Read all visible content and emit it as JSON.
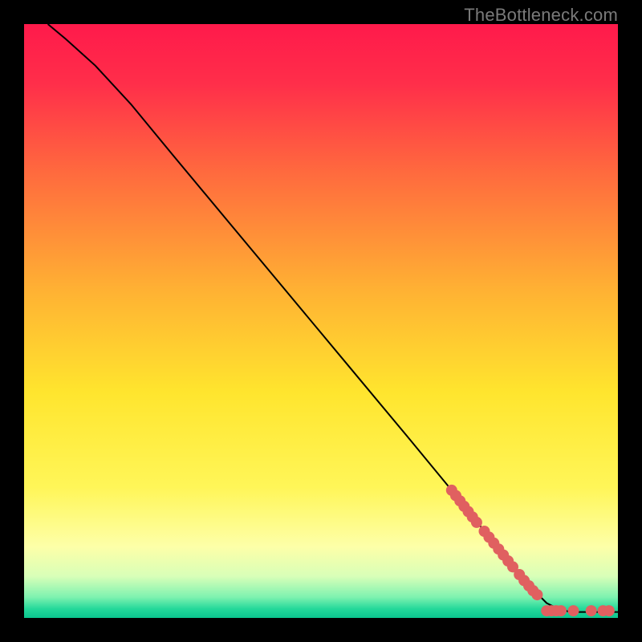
{
  "watermark": "TheBottleneck.com",
  "chart_data": {
    "type": "line",
    "title": "",
    "xlabel": "",
    "ylabel": "",
    "xlim": [
      0,
      100
    ],
    "ylim": [
      0,
      100
    ],
    "gradient_stops": [
      {
        "offset": 0.0,
        "color": "#ff1a4b"
      },
      {
        "offset": 0.1,
        "color": "#ff2e4a"
      },
      {
        "offset": 0.25,
        "color": "#ff6a3e"
      },
      {
        "offset": 0.45,
        "color": "#ffb233"
      },
      {
        "offset": 0.62,
        "color": "#ffe52e"
      },
      {
        "offset": 0.78,
        "color": "#fff658"
      },
      {
        "offset": 0.88,
        "color": "#fdffa8"
      },
      {
        "offset": 0.93,
        "color": "#d8ffb8"
      },
      {
        "offset": 0.965,
        "color": "#7ef2b0"
      },
      {
        "offset": 0.985,
        "color": "#23d89a"
      },
      {
        "offset": 1.0,
        "color": "#0bc58e"
      }
    ],
    "curve": [
      {
        "x": 4.0,
        "y": 100.0
      },
      {
        "x": 7.0,
        "y": 97.5
      },
      {
        "x": 12.0,
        "y": 93.0
      },
      {
        "x": 18.0,
        "y": 86.5
      },
      {
        "x": 25.0,
        "y": 78.0
      },
      {
        "x": 35.0,
        "y": 66.0
      },
      {
        "x": 45.0,
        "y": 54.0
      },
      {
        "x": 55.0,
        "y": 42.0
      },
      {
        "x": 65.0,
        "y": 30.0
      },
      {
        "x": 72.0,
        "y": 21.5
      },
      {
        "x": 78.0,
        "y": 14.0
      },
      {
        "x": 83.0,
        "y": 8.0
      },
      {
        "x": 86.0,
        "y": 4.5
      },
      {
        "x": 88.0,
        "y": 2.5
      },
      {
        "x": 90.0,
        "y": 1.5
      },
      {
        "x": 92.0,
        "y": 1.0
      },
      {
        "x": 95.0,
        "y": 1.0
      },
      {
        "x": 100.0,
        "y": 1.0
      }
    ],
    "markers": [
      {
        "x": 72.0,
        "y": 21.5
      },
      {
        "x": 72.7,
        "y": 20.6
      },
      {
        "x": 73.4,
        "y": 19.7
      },
      {
        "x": 74.1,
        "y": 18.8
      },
      {
        "x": 74.8,
        "y": 17.9
      },
      {
        "x": 75.5,
        "y": 17.0
      },
      {
        "x": 76.2,
        "y": 16.1
      },
      {
        "x": 77.5,
        "y": 14.6
      },
      {
        "x": 78.3,
        "y": 13.6
      },
      {
        "x": 79.1,
        "y": 12.6
      },
      {
        "x": 79.9,
        "y": 11.6
      },
      {
        "x": 80.7,
        "y": 10.6
      },
      {
        "x": 81.5,
        "y": 9.6
      },
      {
        "x": 82.3,
        "y": 8.6
      },
      {
        "x": 83.4,
        "y": 7.3
      },
      {
        "x": 84.2,
        "y": 6.3
      },
      {
        "x": 85.0,
        "y": 5.4
      },
      {
        "x": 85.7,
        "y": 4.6
      },
      {
        "x": 86.4,
        "y": 3.9
      },
      {
        "x": 88.0,
        "y": 1.2
      },
      {
        "x": 88.8,
        "y": 1.2
      },
      {
        "x": 89.6,
        "y": 1.2
      },
      {
        "x": 90.4,
        "y": 1.2
      },
      {
        "x": 92.5,
        "y": 1.2
      },
      {
        "x": 95.5,
        "y": 1.2
      },
      {
        "x": 97.5,
        "y": 1.2
      },
      {
        "x": 98.5,
        "y": 1.2
      }
    ],
    "marker_style": {
      "fill": "#e06060",
      "radius_px": 7
    }
  }
}
